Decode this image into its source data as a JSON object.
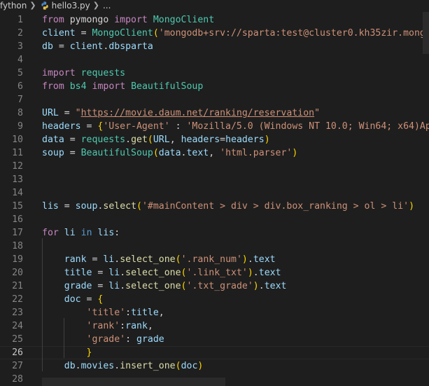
{
  "breadcrumb": {
    "folder": "fython",
    "file": "hello3.py",
    "trail": "..."
  },
  "editor": {
    "active_line": 26,
    "lines": [
      {
        "n": "1",
        "tokens": [
          [
            "k",
            "from"
          ],
          [
            "p",
            " pymongo "
          ],
          [
            "k",
            "import"
          ],
          [
            "p",
            " "
          ],
          [
            "c",
            "MongoClient"
          ]
        ]
      },
      {
        "n": "2",
        "tokens": [
          [
            "v",
            "client"
          ],
          [
            "p",
            " = "
          ],
          [
            "c",
            "MongoClient"
          ],
          [
            "b1",
            "("
          ],
          [
            "s",
            "'mongodb+srv://sparta:test@cluster0.kh35zir.mongo"
          ]
        ]
      },
      {
        "n": "3",
        "tokens": [
          [
            "v",
            "db"
          ],
          [
            "p",
            " = "
          ],
          [
            "v",
            "client"
          ],
          [
            "p",
            "."
          ],
          [
            "v",
            "dbsparta"
          ]
        ]
      },
      {
        "n": "4",
        "tokens": []
      },
      {
        "n": "5",
        "tokens": [
          [
            "k",
            "import"
          ],
          [
            "p",
            " "
          ],
          [
            "c",
            "requests"
          ]
        ]
      },
      {
        "n": "6",
        "tokens": [
          [
            "k",
            "from"
          ],
          [
            "p",
            " "
          ],
          [
            "c",
            "bs4"
          ],
          [
            "p",
            " "
          ],
          [
            "k",
            "import"
          ],
          [
            "p",
            " "
          ],
          [
            "c",
            "BeautifulSoup"
          ]
        ]
      },
      {
        "n": "7",
        "tokens": []
      },
      {
        "n": "8",
        "tokens": [
          [
            "v",
            "URL"
          ],
          [
            "p",
            " = "
          ],
          [
            "s",
            "\""
          ],
          [
            "u",
            "https://movie.daum.net/ranking/reservation"
          ],
          [
            "s",
            "\""
          ]
        ]
      },
      {
        "n": "9",
        "tokens": [
          [
            "v",
            "headers"
          ],
          [
            "p",
            " = "
          ],
          [
            "b1",
            "{"
          ],
          [
            "s",
            "'User-Agent'"
          ],
          [
            "p",
            " : "
          ],
          [
            "s",
            "'Mozilla/5.0 (Windows NT 10.0; Win64; x64)Ap"
          ]
        ]
      },
      {
        "n": "10",
        "tokens": [
          [
            "v",
            "data"
          ],
          [
            "p",
            " = "
          ],
          [
            "c",
            "requests"
          ],
          [
            "p",
            "."
          ],
          [
            "f",
            "get"
          ],
          [
            "b1",
            "("
          ],
          [
            "v",
            "URL"
          ],
          [
            "p",
            ", "
          ],
          [
            "v",
            "headers"
          ],
          [
            "p",
            "="
          ],
          [
            "v",
            "headers"
          ],
          [
            "b1",
            ")"
          ]
        ]
      },
      {
        "n": "11",
        "tokens": [
          [
            "v",
            "soup"
          ],
          [
            "p",
            " = "
          ],
          [
            "c",
            "BeautifulSoup"
          ],
          [
            "b1",
            "("
          ],
          [
            "v",
            "data"
          ],
          [
            "p",
            "."
          ],
          [
            "v",
            "text"
          ],
          [
            "p",
            ", "
          ],
          [
            "s",
            "'html.parser'"
          ],
          [
            "b1",
            ")"
          ]
        ]
      },
      {
        "n": "12",
        "tokens": []
      },
      {
        "n": "13",
        "tokens": []
      },
      {
        "n": "14",
        "tokens": []
      },
      {
        "n": "15",
        "tokens": [
          [
            "v",
            "lis"
          ],
          [
            "p",
            " = "
          ],
          [
            "v",
            "soup"
          ],
          [
            "p",
            "."
          ],
          [
            "f",
            "select"
          ],
          [
            "b1",
            "("
          ],
          [
            "s",
            "'#mainContent > div > div.box_ranking > ol > li'"
          ],
          [
            "b1",
            ")"
          ]
        ]
      },
      {
        "n": "16",
        "tokens": []
      },
      {
        "n": "17",
        "tokens": [
          [
            "k",
            "for"
          ],
          [
            "p",
            " "
          ],
          [
            "v",
            "li"
          ],
          [
            "p",
            " "
          ],
          [
            "kb",
            "in"
          ],
          [
            "p",
            " "
          ],
          [
            "v",
            "lis"
          ],
          [
            "p",
            ":"
          ]
        ]
      },
      {
        "n": "18",
        "tokens": []
      },
      {
        "n": "19",
        "tokens": [
          [
            "p",
            "    "
          ],
          [
            "v",
            "rank"
          ],
          [
            "p",
            " = "
          ],
          [
            "v",
            "li"
          ],
          [
            "p",
            "."
          ],
          [
            "f",
            "select_one"
          ],
          [
            "b1",
            "("
          ],
          [
            "s",
            "'.rank_num'"
          ],
          [
            "b1",
            ")"
          ],
          [
            "p",
            "."
          ],
          [
            "v",
            "text"
          ]
        ]
      },
      {
        "n": "20",
        "tokens": [
          [
            "p",
            "    "
          ],
          [
            "v",
            "title"
          ],
          [
            "p",
            " = "
          ],
          [
            "v",
            "li"
          ],
          [
            "p",
            "."
          ],
          [
            "f",
            "select_one"
          ],
          [
            "b1",
            "("
          ],
          [
            "s",
            "'.link_txt'"
          ],
          [
            "b1",
            ")"
          ],
          [
            "p",
            "."
          ],
          [
            "v",
            "text"
          ]
        ]
      },
      {
        "n": "21",
        "tokens": [
          [
            "p",
            "    "
          ],
          [
            "v",
            "grade"
          ],
          [
            "p",
            " = "
          ],
          [
            "v",
            "li"
          ],
          [
            "p",
            "."
          ],
          [
            "f",
            "select_one"
          ],
          [
            "b1",
            "("
          ],
          [
            "s",
            "'.txt_grade'"
          ],
          [
            "b1",
            ")"
          ],
          [
            "p",
            "."
          ],
          [
            "v",
            "text"
          ]
        ]
      },
      {
        "n": "22",
        "tokens": [
          [
            "p",
            "    "
          ],
          [
            "v",
            "doc"
          ],
          [
            "p",
            " = "
          ],
          [
            "b1",
            "{"
          ]
        ]
      },
      {
        "n": "23",
        "tokens": [
          [
            "p",
            "        "
          ],
          [
            "s",
            "'title'"
          ],
          [
            "p",
            ":"
          ],
          [
            "v",
            "title"
          ],
          [
            "p",
            ","
          ]
        ]
      },
      {
        "n": "24",
        "tokens": [
          [
            "p",
            "        "
          ],
          [
            "s",
            "'rank'"
          ],
          [
            "p",
            ":"
          ],
          [
            "v",
            "rank"
          ],
          [
            "p",
            ","
          ]
        ]
      },
      {
        "n": "25",
        "tokens": [
          [
            "p",
            "        "
          ],
          [
            "s",
            "'grade'"
          ],
          [
            "p",
            ": "
          ],
          [
            "v",
            "grade"
          ]
        ]
      },
      {
        "n": "26",
        "tokens": [
          [
            "p",
            "        "
          ],
          [
            "b1",
            "}"
          ]
        ]
      },
      {
        "n": "27",
        "tokens": [
          [
            "p",
            "    "
          ],
          [
            "v",
            "db"
          ],
          [
            "p",
            "."
          ],
          [
            "v",
            "movies"
          ],
          [
            "p",
            "."
          ],
          [
            "f",
            "insert_one"
          ],
          [
            "b1",
            "("
          ],
          [
            "v",
            "doc"
          ],
          [
            "b1",
            ")"
          ]
        ]
      },
      {
        "n": "28",
        "tokens": []
      }
    ]
  }
}
